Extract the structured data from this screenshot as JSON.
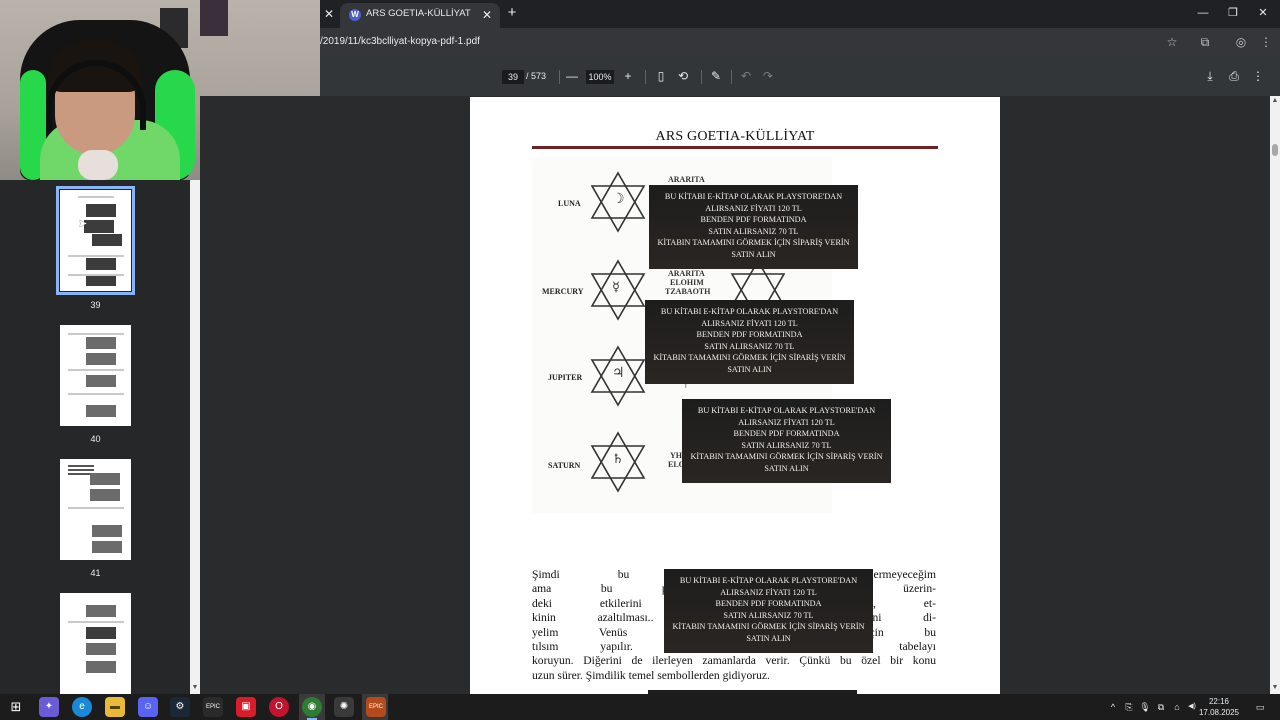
{
  "browser": {
    "tab_title": "ARS GOETIA-KÜLLİYAT",
    "tab_favicon": "W",
    "url": "/2019/11/kc3bclliyat-kopya-pdf-1.pdf",
    "icons": {
      "new_tab": "+",
      "close": "✕",
      "minimize": "—",
      "restore": "❐",
      "bookmark": "☆",
      "extensions": "⧉",
      "profile": "◎",
      "menu": "⋮"
    }
  },
  "pdf_toolbar": {
    "current_page": "39",
    "total_pages": "/ 573",
    "zoom": "100%",
    "icons": {
      "zoom_out": "—",
      "zoom_in": "+",
      "fit": "▯",
      "rotate": "⟲",
      "annotate": "✎",
      "undo": "↶",
      "redo": "↷",
      "download": "⤓",
      "print": "⎙",
      "more": "⋮"
    }
  },
  "thumbnails": [
    {
      "label": "39",
      "active": true
    },
    {
      "label": "40",
      "active": false
    },
    {
      "label": "41",
      "active": false
    },
    {
      "label": "",
      "active": false
    }
  ],
  "page": {
    "title": "ARS GOETIA-KÜLLİYAT",
    "planets": [
      "LUNA",
      "MERCURY",
      "JUPITER",
      "SATURN"
    ],
    "hebrew_labels": [
      [
        "ARARITA",
        ""
      ],
      [
        "ARARITA",
        "ELOHIM",
        "TZABAOTH"
      ],
      [
        "ר"
      ],
      [
        "YH",
        "ELO"
      ]
    ],
    "hexagram_symbols": {
      "luna": "☽",
      "mercury": "☿",
      "jupiter": "♃",
      "saturn": "♄"
    },
    "ad_lines": [
      "BU KİTABI E-KİTAP OLARAK PLAYSTORE'DAN",
      "ALIRSANIZ FİYATI 120 TL",
      "BENDEN PDF FORMATINDA",
      "SATIN ALIRSANIZ 70 TL",
      "KİTABIN TAMAMINI GÖRMEK İÇİN SİPARİŞ VERİN",
      "SATIN ALIN"
    ],
    "body_lines": [
      "Şimdi bu hexagramları in                                                  ermeyeceğim",
      "ama bu pentagram üzeri                                                    asan üzerin-",
      "deki etkilerini engellemek                                                 oğru ise, et-",
      "kinin azaltılması.. sağa d                                                  lır. Hani di-",
      "yelim Venüs Dünya'yı etk                                                  mak için bu",
      "tılsım yapılır. Ya da Merl                                                   bu tabelayı",
      "koruyun. Diğerini de ilerleyen zamanlarda verir. Çünkü bu özel bir konu",
      "uzun sürer. Şimdilik temel sembollerden gidiyoruz."
    ]
  },
  "taskbar": {
    "time": "22:16",
    "date": "17.08.2025",
    "apps": [
      {
        "name": "start",
        "glyph": "⊞",
        "color": "#1c1c1c"
      },
      {
        "name": "copilot",
        "glyph": "✦",
        "color": "#6a5bd6"
      },
      {
        "name": "edge",
        "glyph": "e",
        "color": "#1b8ad6"
      },
      {
        "name": "explorer",
        "glyph": "▬",
        "color": "#e8b93a"
      },
      {
        "name": "discord",
        "glyph": "☺",
        "color": "#5865f2"
      },
      {
        "name": "steam",
        "glyph": "⚙",
        "color": "#1b2838"
      },
      {
        "name": "epic",
        "glyph": "EPIC",
        "color": "#2a2a2a"
      },
      {
        "name": "red-app",
        "glyph": "▣",
        "color": "#d91c2a"
      },
      {
        "name": "opera",
        "glyph": "O",
        "color": "#c0152c"
      },
      {
        "name": "chrome",
        "glyph": "◉",
        "color": "#2f7d32"
      },
      {
        "name": "app-gear",
        "glyph": "✺",
        "color": "#3a3a3a"
      },
      {
        "name": "epic-2",
        "glyph": "EPIC",
        "color": "#b54a1c"
      }
    ],
    "tray": {
      "chevron": "^",
      "icons": [
        "⎘",
        "🎙",
        "⧉",
        "⌂",
        "⎔",
        "◀)"
      ],
      "notification": "▭"
    }
  }
}
